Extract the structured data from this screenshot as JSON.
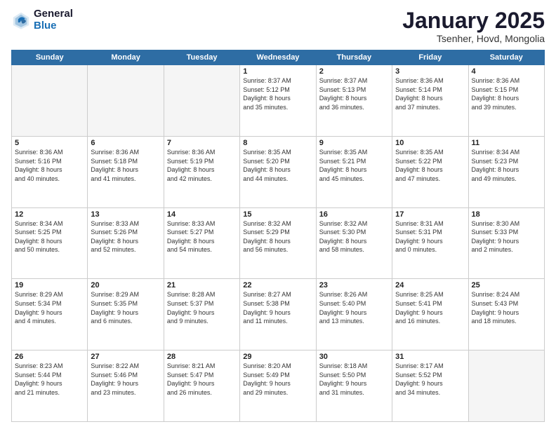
{
  "logo": {
    "line1": "General",
    "line2": "Blue"
  },
  "header": {
    "title": "January 2025",
    "subtitle": "Tsenher, Hovd, Mongolia"
  },
  "weekdays": [
    "Sunday",
    "Monday",
    "Tuesday",
    "Wednesday",
    "Thursday",
    "Friday",
    "Saturday"
  ],
  "weeks": [
    [
      {
        "day": "",
        "info": ""
      },
      {
        "day": "",
        "info": ""
      },
      {
        "day": "",
        "info": ""
      },
      {
        "day": "1",
        "info": "Sunrise: 8:37 AM\nSunset: 5:12 PM\nDaylight: 8 hours\nand 35 minutes."
      },
      {
        "day": "2",
        "info": "Sunrise: 8:37 AM\nSunset: 5:13 PM\nDaylight: 8 hours\nand 36 minutes."
      },
      {
        "day": "3",
        "info": "Sunrise: 8:36 AM\nSunset: 5:14 PM\nDaylight: 8 hours\nand 37 minutes."
      },
      {
        "day": "4",
        "info": "Sunrise: 8:36 AM\nSunset: 5:15 PM\nDaylight: 8 hours\nand 39 minutes."
      }
    ],
    [
      {
        "day": "5",
        "info": "Sunrise: 8:36 AM\nSunset: 5:16 PM\nDaylight: 8 hours\nand 40 minutes."
      },
      {
        "day": "6",
        "info": "Sunrise: 8:36 AM\nSunset: 5:18 PM\nDaylight: 8 hours\nand 41 minutes."
      },
      {
        "day": "7",
        "info": "Sunrise: 8:36 AM\nSunset: 5:19 PM\nDaylight: 8 hours\nand 42 minutes."
      },
      {
        "day": "8",
        "info": "Sunrise: 8:35 AM\nSunset: 5:20 PM\nDaylight: 8 hours\nand 44 minutes."
      },
      {
        "day": "9",
        "info": "Sunrise: 8:35 AM\nSunset: 5:21 PM\nDaylight: 8 hours\nand 45 minutes."
      },
      {
        "day": "10",
        "info": "Sunrise: 8:35 AM\nSunset: 5:22 PM\nDaylight: 8 hours\nand 47 minutes."
      },
      {
        "day": "11",
        "info": "Sunrise: 8:34 AM\nSunset: 5:23 PM\nDaylight: 8 hours\nand 49 minutes."
      }
    ],
    [
      {
        "day": "12",
        "info": "Sunrise: 8:34 AM\nSunset: 5:25 PM\nDaylight: 8 hours\nand 50 minutes."
      },
      {
        "day": "13",
        "info": "Sunrise: 8:33 AM\nSunset: 5:26 PM\nDaylight: 8 hours\nand 52 minutes."
      },
      {
        "day": "14",
        "info": "Sunrise: 8:33 AM\nSunset: 5:27 PM\nDaylight: 8 hours\nand 54 minutes."
      },
      {
        "day": "15",
        "info": "Sunrise: 8:32 AM\nSunset: 5:29 PM\nDaylight: 8 hours\nand 56 minutes."
      },
      {
        "day": "16",
        "info": "Sunrise: 8:32 AM\nSunset: 5:30 PM\nDaylight: 8 hours\nand 58 minutes."
      },
      {
        "day": "17",
        "info": "Sunrise: 8:31 AM\nSunset: 5:31 PM\nDaylight: 9 hours\nand 0 minutes."
      },
      {
        "day": "18",
        "info": "Sunrise: 8:30 AM\nSunset: 5:33 PM\nDaylight: 9 hours\nand 2 minutes."
      }
    ],
    [
      {
        "day": "19",
        "info": "Sunrise: 8:29 AM\nSunset: 5:34 PM\nDaylight: 9 hours\nand 4 minutes."
      },
      {
        "day": "20",
        "info": "Sunrise: 8:29 AM\nSunset: 5:35 PM\nDaylight: 9 hours\nand 6 minutes."
      },
      {
        "day": "21",
        "info": "Sunrise: 8:28 AM\nSunset: 5:37 PM\nDaylight: 9 hours\nand 9 minutes."
      },
      {
        "day": "22",
        "info": "Sunrise: 8:27 AM\nSunset: 5:38 PM\nDaylight: 9 hours\nand 11 minutes."
      },
      {
        "day": "23",
        "info": "Sunrise: 8:26 AM\nSunset: 5:40 PM\nDaylight: 9 hours\nand 13 minutes."
      },
      {
        "day": "24",
        "info": "Sunrise: 8:25 AM\nSunset: 5:41 PM\nDaylight: 9 hours\nand 16 minutes."
      },
      {
        "day": "25",
        "info": "Sunrise: 8:24 AM\nSunset: 5:43 PM\nDaylight: 9 hours\nand 18 minutes."
      }
    ],
    [
      {
        "day": "26",
        "info": "Sunrise: 8:23 AM\nSunset: 5:44 PM\nDaylight: 9 hours\nand 21 minutes."
      },
      {
        "day": "27",
        "info": "Sunrise: 8:22 AM\nSunset: 5:46 PM\nDaylight: 9 hours\nand 23 minutes."
      },
      {
        "day": "28",
        "info": "Sunrise: 8:21 AM\nSunset: 5:47 PM\nDaylight: 9 hours\nand 26 minutes."
      },
      {
        "day": "29",
        "info": "Sunrise: 8:20 AM\nSunset: 5:49 PM\nDaylight: 9 hours\nand 29 minutes."
      },
      {
        "day": "30",
        "info": "Sunrise: 8:18 AM\nSunset: 5:50 PM\nDaylight: 9 hours\nand 31 minutes."
      },
      {
        "day": "31",
        "info": "Sunrise: 8:17 AM\nSunset: 5:52 PM\nDaylight: 9 hours\nand 34 minutes."
      },
      {
        "day": "",
        "info": ""
      }
    ]
  ]
}
